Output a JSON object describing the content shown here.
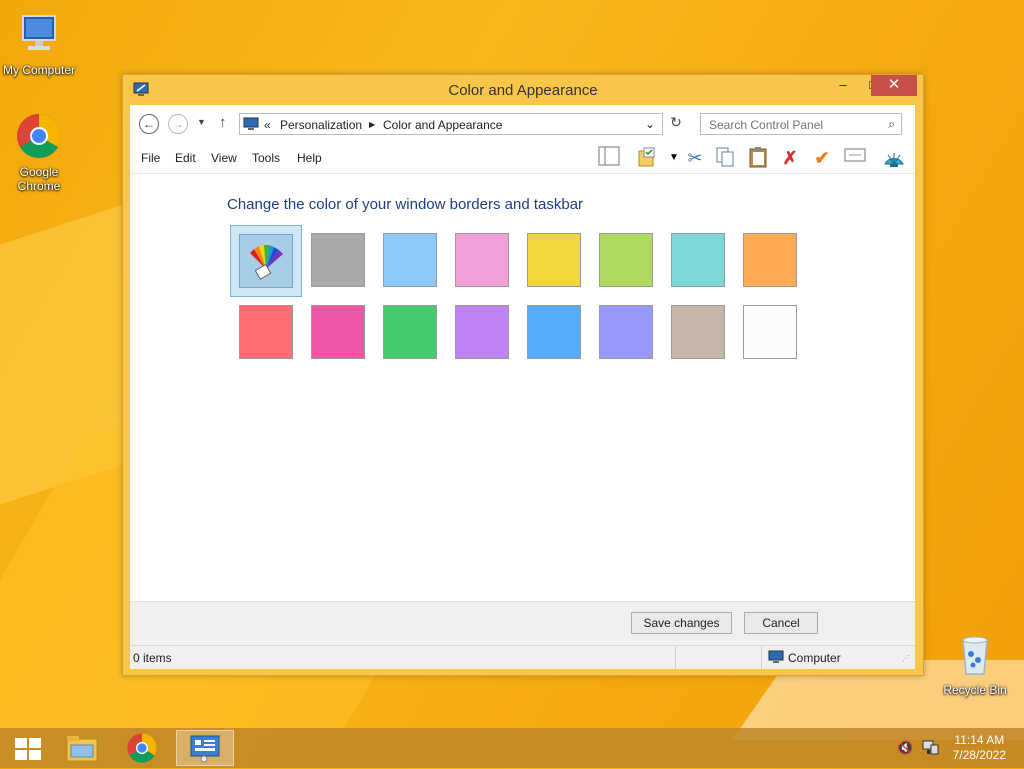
{
  "desktop": {
    "icons": [
      {
        "label": "My Computer"
      },
      {
        "label": "Google Chrome"
      },
      {
        "label": "Recycle Bin"
      }
    ]
  },
  "window": {
    "title": "Color and Appearance",
    "buttons": {
      "minimize": "–",
      "maximize": "□",
      "close": "✕"
    },
    "address": {
      "prefix": "«",
      "crumbs": [
        "Personalization",
        "Color and Appearance"
      ]
    },
    "search": {
      "placeholder": "Search Control Panel"
    },
    "menu": [
      "File",
      "Edit",
      "View",
      "Tools",
      "Help"
    ],
    "heading": "Change the color of your window borders and taskbar",
    "swatches_row1": [
      "#a9a9a9",
      "#8ccaf9",
      "#f3a0d8",
      "#f1d640",
      "#b1d962",
      "#7ed8d8",
      "#ffaa55"
    ],
    "swatches_row2": [
      "#ff6c73",
      "#f055a8",
      "#45cb6d",
      "#c083f4",
      "#58abfb",
      "#9898fb",
      "#c5b6aa",
      "#fcfcfc"
    ],
    "save_label": "Save changes",
    "cancel_label": "Cancel",
    "status_items": "0 items",
    "status_location": "Computer"
  },
  "taskbar": {
    "time": "11:14 AM",
    "date": "7/28/2022"
  },
  "colors": {
    "accent": "#f9c649",
    "heading": "#1e3f7a",
    "close": "#c7504a"
  }
}
